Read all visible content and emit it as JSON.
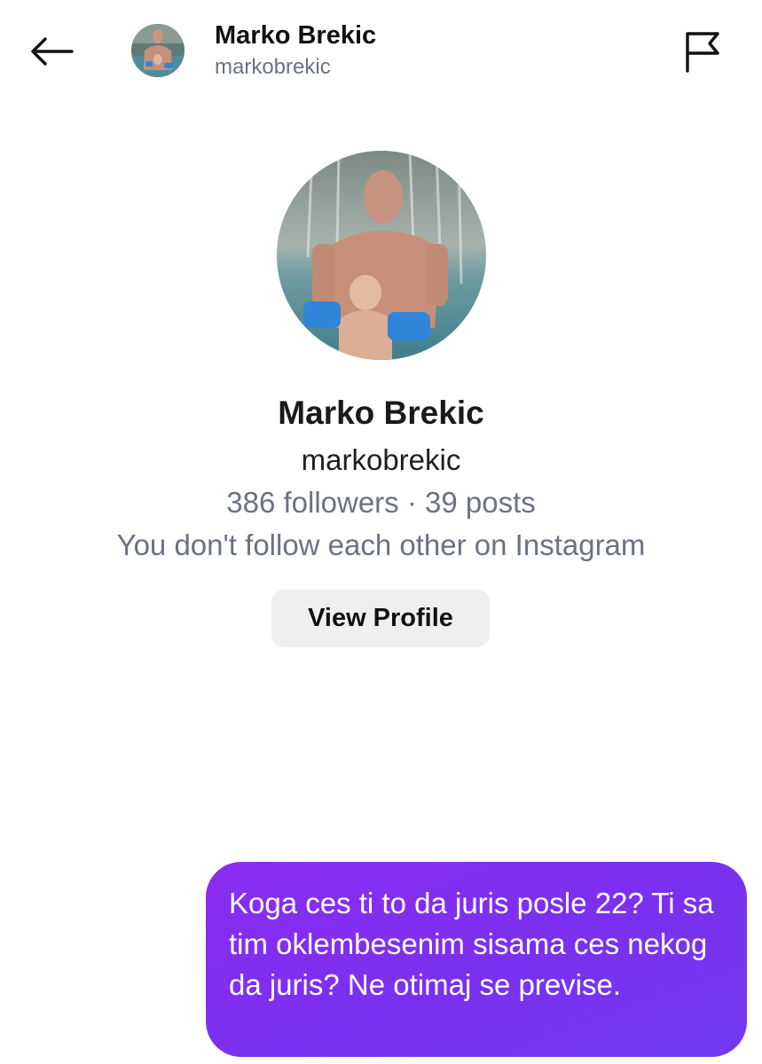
{
  "header": {
    "name": "Marko Brekic",
    "username": "markobrekic",
    "back_icon": "arrow-left-icon",
    "report_icon": "flag-icon"
  },
  "profile": {
    "name": "Marko Brekic",
    "username": "markobrekic",
    "stats": "386 followers · 39 posts",
    "mutual_status": "You don't follow each other on Instagram",
    "view_profile_label": "View Profile"
  },
  "messages": [
    {
      "sender": "me",
      "text": "Koga ces ti to da juris posle 22? Ti sa tim oklembesenim sisama ces nekog da juris? Ne otimaj se previse."
    }
  ],
  "colors": {
    "bubble_start": "#8b2cf2",
    "bubble_end": "#6f3bf0",
    "secondary_text": "#6b7280",
    "button_bg": "#efefef"
  }
}
